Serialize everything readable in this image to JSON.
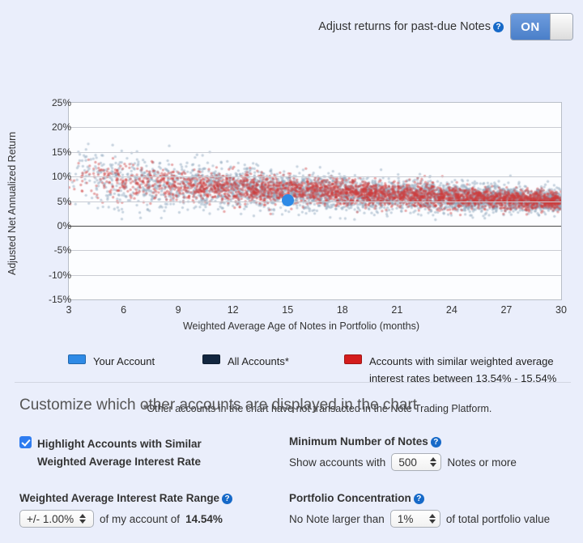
{
  "toggle": {
    "label": "Adjust returns for past-due Notes",
    "help": "?",
    "state_label": "ON"
  },
  "chart_data": {
    "type": "scatter",
    "title": "",
    "xlabel": "Weighted Average Age of Notes in Portfolio (months)",
    "ylabel": "Adjusted Net Annualized Return",
    "xlim": [
      3,
      30
    ],
    "ylim": [
      -15,
      25
    ],
    "xticks": [
      3,
      6,
      9,
      12,
      15,
      18,
      21,
      24,
      27,
      30
    ],
    "yticks": [
      "25%",
      "20%",
      "15%",
      "10%",
      "5%",
      "0%",
      "-5%",
      "-10%",
      "-15%"
    ],
    "ytick_values": [
      25,
      20,
      15,
      10,
      5,
      0,
      -5,
      -10,
      -15
    ],
    "grid": true,
    "zero_line": 0,
    "legend_position": "below",
    "series": [
      {
        "name": "All Accounts*",
        "color": "#12263f",
        "point_color": "#8fa8bd",
        "n_points": 4200,
        "description": "Dense cloud declining from ~10% mean at 3 months to ~5% mean at 30 months; spread narrows with age"
      },
      {
        "name": "Accounts with similar weighted average interest rates between 13.54% - 15.54%",
        "color": "#d41c1c",
        "point_color": "#cf3b3b",
        "n_points": 3000,
        "description": "Overlapping red cloud, slightly tighter band, same declining trend"
      },
      {
        "name": "Your Account",
        "color": "#2e8ae6",
        "points": [
          {
            "x": 15.0,
            "y": 5.2
          }
        ],
        "n_points": 1
      }
    ]
  },
  "legend": [
    {
      "label": "Your Account",
      "color": "#2e8ae6"
    },
    {
      "label": "All Accounts*",
      "color": "#12263f"
    },
    {
      "label": "Accounts with similar weighted average",
      "label2": "interest rates between 13.54% - 15.54%",
      "color": "#d41c1c"
    }
  ],
  "footnote": "*Other accounts in the chart have not transacted in the Note Trading Platform.",
  "customize": {
    "title": "Customize which other accounts are displayed in the chart",
    "highlight": {
      "checked": true,
      "label_line1": "Highlight Accounts with Similar",
      "label_line2": "Weighted Average Interest Rate"
    },
    "rate_range": {
      "heading": "Weighted Average Interest Rate Range",
      "help": "?",
      "value": "+/- 1.00%",
      "suffix": "of my account of",
      "account_rate": "14.54%"
    },
    "min_notes": {
      "heading": "Minimum Number of Notes",
      "help": "?",
      "prefix": "Show accounts with",
      "value": "500",
      "suffix": "Notes or more"
    },
    "concentration": {
      "heading": "Portfolio Concentration",
      "help": "?",
      "prefix": "No Note larger than",
      "value": "1%",
      "suffix": "of total portfolio value"
    }
  }
}
